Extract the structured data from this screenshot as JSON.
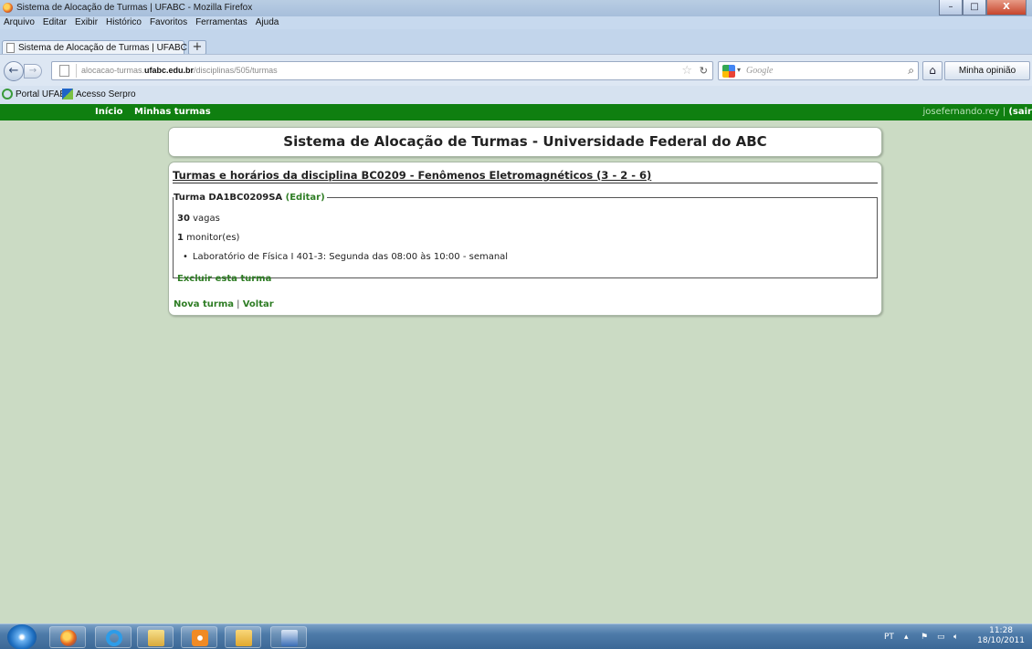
{
  "window": {
    "title": "Sistema de Alocação de Turmas | UFABC - Mozilla Firefox",
    "min": "–",
    "max": "□",
    "close": "X"
  },
  "menu": [
    "Arquivo",
    "Editar",
    "Exibir",
    "Histórico",
    "Favoritos",
    "Ferramentas",
    "Ajuda"
  ],
  "tabs": [
    {
      "label": "Sistema de Alocação de Turmas | UFABC"
    }
  ],
  "newtab": "+",
  "nav": {
    "back": "←",
    "forward": "→",
    "url_prefix": "alocacao-turmas.",
    "url_domain": "ufabc.edu.br",
    "url_path": "/disciplinas/505/turmas",
    "search_placeholder": "Google",
    "home": "⌂",
    "feedback": "Minha opinião"
  },
  "bookmarks": [
    "Portal UFABC",
    "Acesso Serpro"
  ],
  "site_nav": {
    "inicio": "Início",
    "minhas_turmas": "Minhas turmas",
    "user": "josefernando.rey",
    "separator": " | ",
    "logout": "(sair"
  },
  "header": "Sistema de Alocação de Turmas - Universidade Federal do ABC",
  "course": {
    "heading": "Turmas e horários da disciplina BC0209 - Fenômenos Eletromagnéticos (3 - 2 - 6)",
    "turma": {
      "legend": "Turma DA1BC0209SA",
      "edit": "(Editar)",
      "vagas_count": "30",
      "vagas_label": " vagas",
      "monitor_count": "1",
      "monitor_label": " monitor(es)",
      "schedule": "Laboratório de Física I 401-3: Segunda das 08:00 às 10:00 - semanal",
      "delete": "Excluir esta turma"
    },
    "new_turma": "Nova turma",
    "link_separator": " | ",
    "back": "Voltar"
  },
  "tray": {
    "lang": "PT",
    "time": "11:28",
    "date": "18/10/2011"
  },
  "colors": {
    "site_nav_bg": "#0f7f10",
    "page_bg": "#cbdbc4",
    "link_green": "#2e7d24"
  }
}
